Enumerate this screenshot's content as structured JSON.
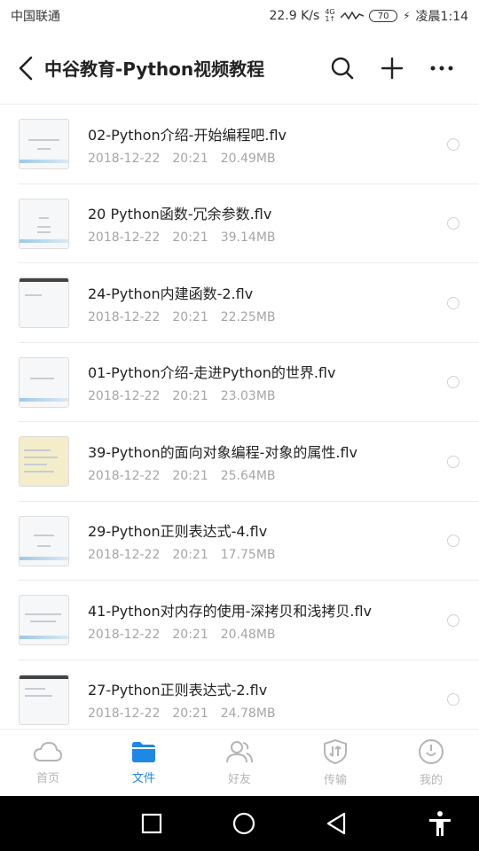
{
  "status": {
    "carrier": "中国联通",
    "net_speed": "22.9 K/s",
    "net_type_top": "4G",
    "net_type_bottom": "1↑",
    "battery": "70",
    "time": "凌晨1:14"
  },
  "header": {
    "title": "中谷教育-Python视频教程"
  },
  "files": [
    {
      "name": "02-Python介绍-开始编程吧.flv",
      "date": "2018-12-22",
      "time": "20:21",
      "size": "20.49MB"
    },
    {
      "name": "20  Python函数-冗余参数.flv",
      "date": "2018-12-22",
      "time": "20:21",
      "size": "39.14MB"
    },
    {
      "name": "24-Python内建函数-2.flv",
      "date": "2018-12-22",
      "time": "20:21",
      "size": "22.25MB"
    },
    {
      "name": "01-Python介绍-走进Python的世界.flv",
      "date": "2018-12-22",
      "time": "20:21",
      "size": "23.03MB"
    },
    {
      "name": "39-Python的面向对象编程-对象的属性.flv",
      "date": "2018-12-22",
      "time": "20:21",
      "size": "25.64MB"
    },
    {
      "name": "29-Python正则表达式-4.flv",
      "date": "2018-12-22",
      "time": "20:21",
      "size": "17.75MB"
    },
    {
      "name": "41-Python对内存的使用-深拷贝和浅拷贝.flv",
      "date": "2018-12-22",
      "time": "20:21",
      "size": "20.48MB"
    },
    {
      "name": "27-Python正则表达式-2.flv",
      "date": "2018-12-22",
      "time": "20:21",
      "size": "24.78MB"
    }
  ],
  "tabs": [
    {
      "label": "首页",
      "icon": "cloud-icon"
    },
    {
      "label": "文件",
      "icon": "folder-icon"
    },
    {
      "label": "好友",
      "icon": "friends-icon"
    },
    {
      "label": "传输",
      "icon": "transfer-icon"
    },
    {
      "label": "我的",
      "icon": "profile-icon"
    }
  ],
  "colors": {
    "accent": "#1e88e5",
    "inactive": "#b5b5b5"
  }
}
